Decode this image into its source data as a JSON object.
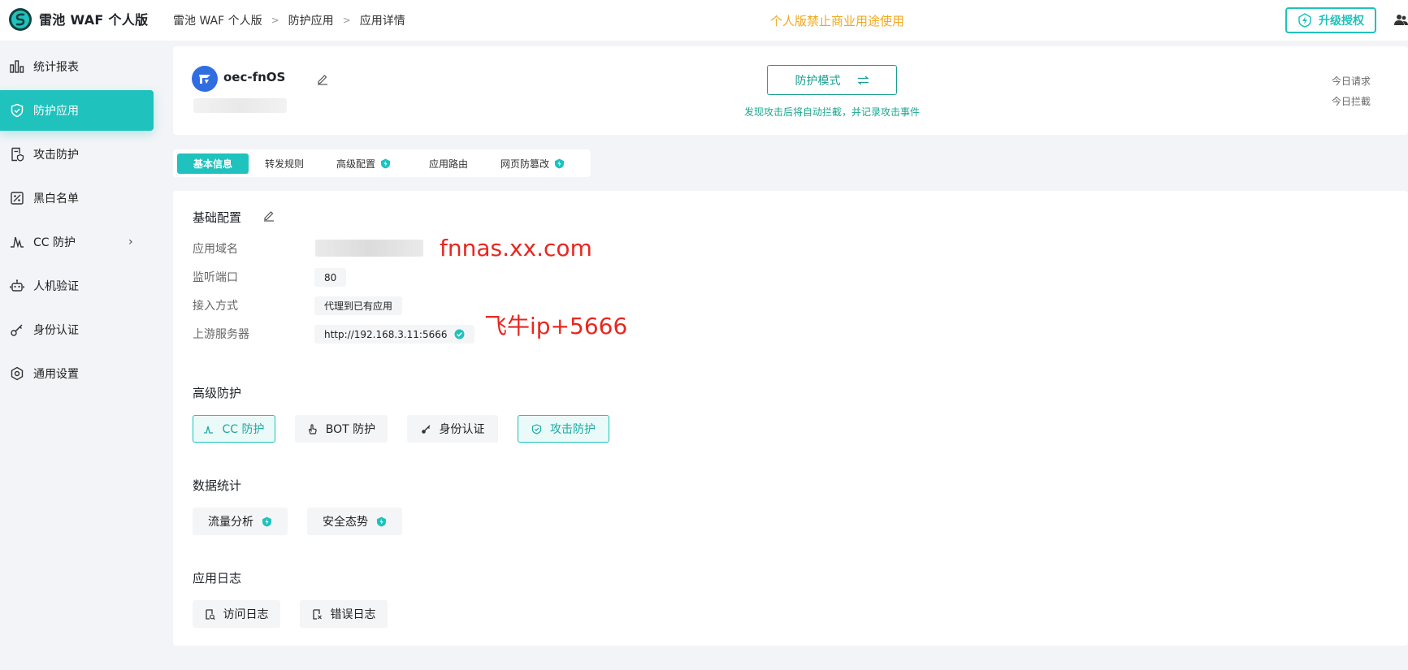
{
  "app": {
    "title": "雷池 WAF 个人版"
  },
  "breadcrumb": [
    "雷池 WAF 个人版",
    "防护应用",
    "应用详情"
  ],
  "notice": "个人版禁止商业用途使用",
  "upgrade_label": "升级授权",
  "sidebar": {
    "items": [
      {
        "label": "统计报表",
        "icon": "bar-chart-icon"
      },
      {
        "label": "防护应用",
        "icon": "shield-icon",
        "active": true
      },
      {
        "label": "攻击防护",
        "icon": "document-shield-icon"
      },
      {
        "label": "黑白名单",
        "icon": "list-filter-icon"
      },
      {
        "label": "CC 防护",
        "icon": "pulse-icon",
        "has_children": true
      },
      {
        "label": "人机验证",
        "icon": "robot-icon"
      },
      {
        "label": "身份认证",
        "icon": "key-icon"
      },
      {
        "label": "通用设置",
        "icon": "gear-icon"
      }
    ]
  },
  "application": {
    "name": "oec-fnOS",
    "mode_label": "防护模式",
    "mode_desc": "发现攻击后将自动拦截，并记录攻击事件",
    "today_requests_label": "今日请求",
    "today_blocked_label": "今日拦截"
  },
  "tabs": [
    {
      "label": "基本信息",
      "active": true
    },
    {
      "label": "转发规则"
    },
    {
      "label": "高级配置",
      "pro": true
    },
    {
      "label": "应用路由"
    },
    {
      "label": "网页防篡改",
      "pro": true
    }
  ],
  "basic_config": {
    "title": "基础配置",
    "fields": {
      "domain_label": "应用域名",
      "port_label": "监听端口",
      "port_value": "80",
      "access_label": "接入方式",
      "access_value": "代理到已有应用",
      "upstream_label": "上游服务器",
      "upstream_value": "http://192.168.3.11:5666"
    }
  },
  "annotations": {
    "domain": "fnnas.xx.com",
    "upstream": "飞牛ip+5666"
  },
  "advanced_protection": {
    "title": "高级防护",
    "buttons": [
      {
        "label": "CC 防护",
        "enabled": true
      },
      {
        "label": "BOT 防护",
        "enabled": false
      },
      {
        "label": "身份认证",
        "enabled": false
      },
      {
        "label": "攻击防护",
        "enabled": true
      }
    ]
  },
  "data_stats": {
    "title": "数据统计",
    "buttons": [
      {
        "label": "流量分析",
        "pro": true
      },
      {
        "label": "安全态势",
        "pro": true
      }
    ]
  },
  "app_logs": {
    "title": "应用日志",
    "buttons": [
      {
        "label": "访问日志"
      },
      {
        "label": "错误日志"
      }
    ]
  },
  "colors": {
    "accent": "#1fc2bc",
    "notice": "#f2a81d",
    "annotation": "#e8271f"
  }
}
